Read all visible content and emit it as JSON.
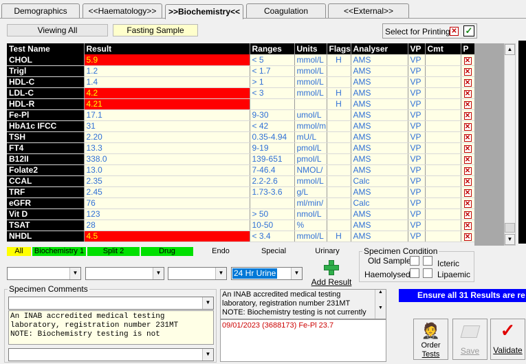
{
  "tabs": [
    {
      "label": "Demographics",
      "active": false
    },
    {
      "label": "<<Haematology>>",
      "active": false
    },
    {
      "label": ">>Biochemistry<<",
      "active": true
    },
    {
      "label": "Coagulation",
      "active": false
    },
    {
      "label": "<<External>>",
      "active": false
    }
  ],
  "view": {
    "viewing_all": "Viewing All",
    "sample_type": "Fasting Sample"
  },
  "print": {
    "label": "Select for Printing"
  },
  "columns": [
    "Test Name",
    "Result",
    "Ranges",
    "Units",
    "Flags",
    "Analyser",
    "VP",
    "Cmt",
    "P"
  ],
  "rows": [
    {
      "name": "CHOL",
      "result": "5.9",
      "range": "< 5",
      "units": "mmol/L",
      "flag": "H",
      "analyser": "AMS",
      "vp": "VP",
      "abnormal": true
    },
    {
      "name": "Trigl",
      "result": "1.2",
      "range": "< 1.7",
      "units": "mmol/L",
      "flag": "",
      "analyser": "AMS",
      "vp": "VP",
      "abnormal": false
    },
    {
      "name": "HDL-C",
      "result": "1.4",
      "range": "> 1",
      "units": "mmol/L",
      "flag": "",
      "analyser": "AMS",
      "vp": "VP",
      "abnormal": false
    },
    {
      "name": "LDL-C",
      "result": "4.2",
      "range": "< 3",
      "units": "mmol/L",
      "flag": "H",
      "analyser": "AMS",
      "vp": "VP",
      "abnormal": true
    },
    {
      "name": "HDL-R",
      "result": "4.21",
      "range": "",
      "units": "",
      "flag": "H",
      "analyser": "AMS",
      "vp": "VP",
      "abnormal": true
    },
    {
      "name": "Fe-Pl",
      "result": "17.1",
      "range": "9-30",
      "units": "umol/L",
      "flag": "",
      "analyser": "AMS",
      "vp": "VP",
      "abnormal": false
    },
    {
      "name": "HbA1c IFCC",
      "result": "31",
      "range": "< 42",
      "units": "mmol/m",
      "flag": "",
      "analyser": "AMS",
      "vp": "VP",
      "abnormal": false
    },
    {
      "name": "TSH",
      "result": "2.20",
      "range": "0.35-4.94",
      "units": "mU/L",
      "flag": "",
      "analyser": "AMS",
      "vp": "VP",
      "abnormal": false
    },
    {
      "name": "FT4",
      "result": "13.3",
      "range": "9-19",
      "units": "pmol/L",
      "flag": "",
      "analyser": "AMS",
      "vp": "VP",
      "abnormal": false
    },
    {
      "name": "B12II",
      "result": "338.0",
      "range": "139-651",
      "units": "pmol/L",
      "flag": "",
      "analyser": "AMS",
      "vp": "VP",
      "abnormal": false
    },
    {
      "name": "Folate2",
      "result": "13.0",
      "range": "7-46.4",
      "units": "NMOL/",
      "flag": "",
      "analyser": "AMS",
      "vp": "VP",
      "abnormal": false
    },
    {
      "name": "CCAL",
      "result": "2.35",
      "range": "2.2-2.6",
      "units": "mmol/L",
      "flag": "",
      "analyser": "Calc",
      "vp": "VP",
      "abnormal": false
    },
    {
      "name": "TRF",
      "result": "2.45",
      "range": "1.73-3.6",
      "units": "g/L",
      "flag": "",
      "analyser": "AMS",
      "vp": "VP",
      "abnormal": false
    },
    {
      "name": "eGFR",
      "result": "76",
      "range": "",
      "units": "ml/min/",
      "flag": "",
      "analyser": "Calc",
      "vp": "VP",
      "abnormal": false
    },
    {
      "name": "Vit D",
      "result": "123",
      "range": "> 50",
      "units": "nmol/L",
      "flag": "",
      "analyser": "AMS",
      "vp": "VP",
      "abnormal": false
    },
    {
      "name": "TSAT",
      "result": "28",
      "range": "10-50",
      "units": "%",
      "flag": "",
      "analyser": "AMS",
      "vp": "VP",
      "abnormal": false
    },
    {
      "name": "NHDL",
      "result": "4.5",
      "range": "< 3.4",
      "units": "mmol/L",
      "flag": "H",
      "analyser": "AMS",
      "vp": "VP",
      "abnormal": true
    }
  ],
  "filters": [
    {
      "label": "All",
      "color": "#ffff00"
    },
    {
      "label": "Biochemistry 1",
      "color": "#00e000"
    },
    {
      "label": "Split 2",
      "color": "#00e000"
    },
    {
      "label": "Drug",
      "color": "#00e000"
    },
    {
      "label": "Endo",
      "color": ""
    },
    {
      "label": "Special",
      "color": ""
    },
    {
      "label": "Urinary",
      "color": ""
    }
  ],
  "combos": {
    "c1": "",
    "c2": "",
    "c3": "",
    "c4": "24 Hr Urine"
  },
  "add_result": {
    "label": "Add Result"
  },
  "specimen_condition": {
    "title": "Specimen Condition",
    "old_sample": "Old Sample",
    "haemolysed": "Haemolysed",
    "icteric": "Icteric",
    "lipaemic": "Lipaemic"
  },
  "specimen_comments": {
    "title": "Specimen Comments",
    "text": "An INAB accredited medical testing laboratory, registration number 231MT\nNOTE: Biochemistry testing is not"
  },
  "info_text": "An INAB accredited medical testing laboratory, registration number 231MT\nNOTE: Biochemistry testing is not currently",
  "history": "09/01/2023 (3688173) Fe-Pl 23.7",
  "banner": "Ensure all 31 Results are re",
  "buttons": {
    "order_line1": "Order",
    "order_line2": "Tests",
    "save": "Save",
    "validate": "Validate"
  }
}
